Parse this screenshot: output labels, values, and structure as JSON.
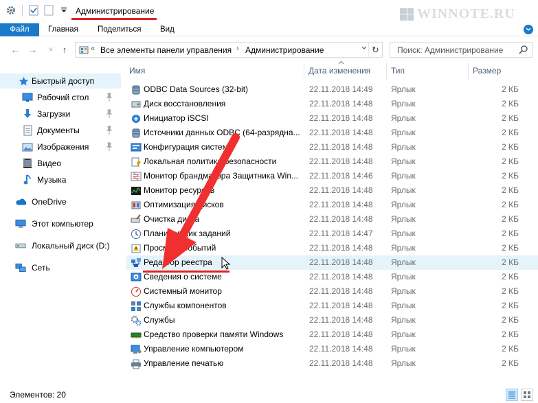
{
  "window": {
    "title": "Администрирование"
  },
  "watermark": "WINNOTE.RU",
  "ribbon": {
    "file": "Файл",
    "tabs": [
      "Главная",
      "Поделиться",
      "Вид"
    ]
  },
  "address": {
    "root_crumb": "Все элементы панели управления",
    "current_crumb": "Администрирование",
    "back_glyph": "←",
    "forward_glyph": "→",
    "up_glyph": "↑",
    "recent_glyph": "˅",
    "overflow_glyph": "«",
    "refresh_glyph": "↻"
  },
  "search": {
    "placeholder": "Поиск: Администрирование"
  },
  "nav": {
    "items": [
      {
        "label": "Быстрый доступ",
        "icon": "star-icon",
        "selected": true,
        "pinned": false
      },
      {
        "label": "Рабочий стол",
        "icon": "desktop-icon",
        "selected": false,
        "pinned": true
      },
      {
        "label": "Загрузки",
        "icon": "downloads-icon",
        "selected": false,
        "pinned": true
      },
      {
        "label": "Документы",
        "icon": "documents-icon",
        "selected": false,
        "pinned": true
      },
      {
        "label": "Изображения",
        "icon": "pictures-icon",
        "selected": false,
        "pinned": true
      },
      {
        "label": "Видео",
        "icon": "video-icon",
        "selected": false,
        "pinned": false
      },
      {
        "label": "Музыка",
        "icon": "music-icon",
        "selected": false,
        "pinned": false
      },
      {
        "label": "OneDrive",
        "icon": "onedrive-icon",
        "selected": false,
        "pinned": false
      },
      {
        "label": "Этот компьютер",
        "icon": "computer-icon",
        "selected": false,
        "pinned": false
      },
      {
        "label": "Локальный диск (D:)",
        "icon": "drive-icon",
        "selected": false,
        "pinned": false
      },
      {
        "label": "Сеть",
        "icon": "network-icon",
        "selected": false,
        "pinned": false
      }
    ]
  },
  "columns": {
    "name": "Имя",
    "date": "Дата изменения",
    "type": "Тип",
    "size": "Размер"
  },
  "files": [
    {
      "name": "ODBC Data Sources (32-bit)",
      "date": "22.11.2018 14:49",
      "type": "Ярлык",
      "size": "2 КБ",
      "icon": "odbc-icon"
    },
    {
      "name": "Диск восстановления",
      "date": "22.11.2018 14:48",
      "type": "Ярлык",
      "size": "2 КБ",
      "icon": "recovery-drive-icon"
    },
    {
      "name": "Инициатор iSCSI",
      "date": "22.11.2018 14:48",
      "type": "Ярлык",
      "size": "2 КБ",
      "icon": "iscsi-icon"
    },
    {
      "name": "Источники данных ODBC (64-разрядна...",
      "date": "22.11.2018 14:48",
      "type": "Ярлык",
      "size": "2 КБ",
      "icon": "odbc-icon"
    },
    {
      "name": "Конфигурация системы",
      "date": "22.11.2018 14:48",
      "type": "Ярлык",
      "size": "2 КБ",
      "icon": "msconfig-icon"
    },
    {
      "name": "Локальная политика безопасности",
      "date": "22.11.2018 14:48",
      "type": "Ярлык",
      "size": "2 КБ",
      "icon": "security-policy-icon"
    },
    {
      "name": "Монитор брандмауэра Защитника Win...",
      "date": "22.11.2018 14:46",
      "type": "Ярлык",
      "size": "2 КБ",
      "icon": "firewall-icon"
    },
    {
      "name": "Монитор ресурсов",
      "date": "22.11.2018 14:48",
      "type": "Ярлык",
      "size": "2 КБ",
      "icon": "resource-monitor-icon"
    },
    {
      "name": "Оптимизация дисков",
      "date": "22.11.2018 14:48",
      "type": "Ярлык",
      "size": "2 КБ",
      "icon": "defrag-icon"
    },
    {
      "name": "Очистка диска",
      "date": "22.11.2018 14:48",
      "type": "Ярлык",
      "size": "2 КБ",
      "icon": "disk-cleanup-icon"
    },
    {
      "name": "Планировщик заданий",
      "date": "22.11.2018 14:47",
      "type": "Ярлык",
      "size": "2 КБ",
      "icon": "task-scheduler-icon"
    },
    {
      "name": "Просмотр событий",
      "date": "22.11.2018 14:48",
      "type": "Ярлык",
      "size": "2 КБ",
      "icon": "event-viewer-icon"
    },
    {
      "name": "Редактор реестра",
      "date": "22.11.2018 14:48",
      "type": "Ярлык",
      "size": "2 КБ",
      "icon": "regedit-icon",
      "selected": true
    },
    {
      "name": "Сведения о системе",
      "date": "22.11.2018 14:48",
      "type": "Ярлык",
      "size": "2 КБ",
      "icon": "system-info-icon"
    },
    {
      "name": "Системный монитор",
      "date": "22.11.2018 14:48",
      "type": "Ярлык",
      "size": "2 КБ",
      "icon": "perfmon-icon"
    },
    {
      "name": "Службы компонентов",
      "date": "22.11.2018 14:48",
      "type": "Ярлык",
      "size": "2 КБ",
      "icon": "component-services-icon"
    },
    {
      "name": "Службы",
      "date": "22.11.2018 14:48",
      "type": "Ярлык",
      "size": "2 КБ",
      "icon": "services-icon"
    },
    {
      "name": "Средство проверки памяти Windows",
      "date": "22.11.2018 14:48",
      "type": "Ярлык",
      "size": "2 КБ",
      "icon": "memory-diagnostic-icon"
    },
    {
      "name": "Управление компьютером",
      "date": "22.11.2018 14:48",
      "type": "Ярлык",
      "size": "2 КБ",
      "icon": "computer-management-icon"
    },
    {
      "name": "Управление печатью",
      "date": "22.11.2018 14:48",
      "type": "Ярлык",
      "size": "2 КБ",
      "icon": "print-management-icon"
    }
  ],
  "status": {
    "text": "Элементов: 20"
  },
  "colors": {
    "accent": "#1979ca",
    "selection": "#e5f3fb",
    "annotation": "#e02020"
  }
}
